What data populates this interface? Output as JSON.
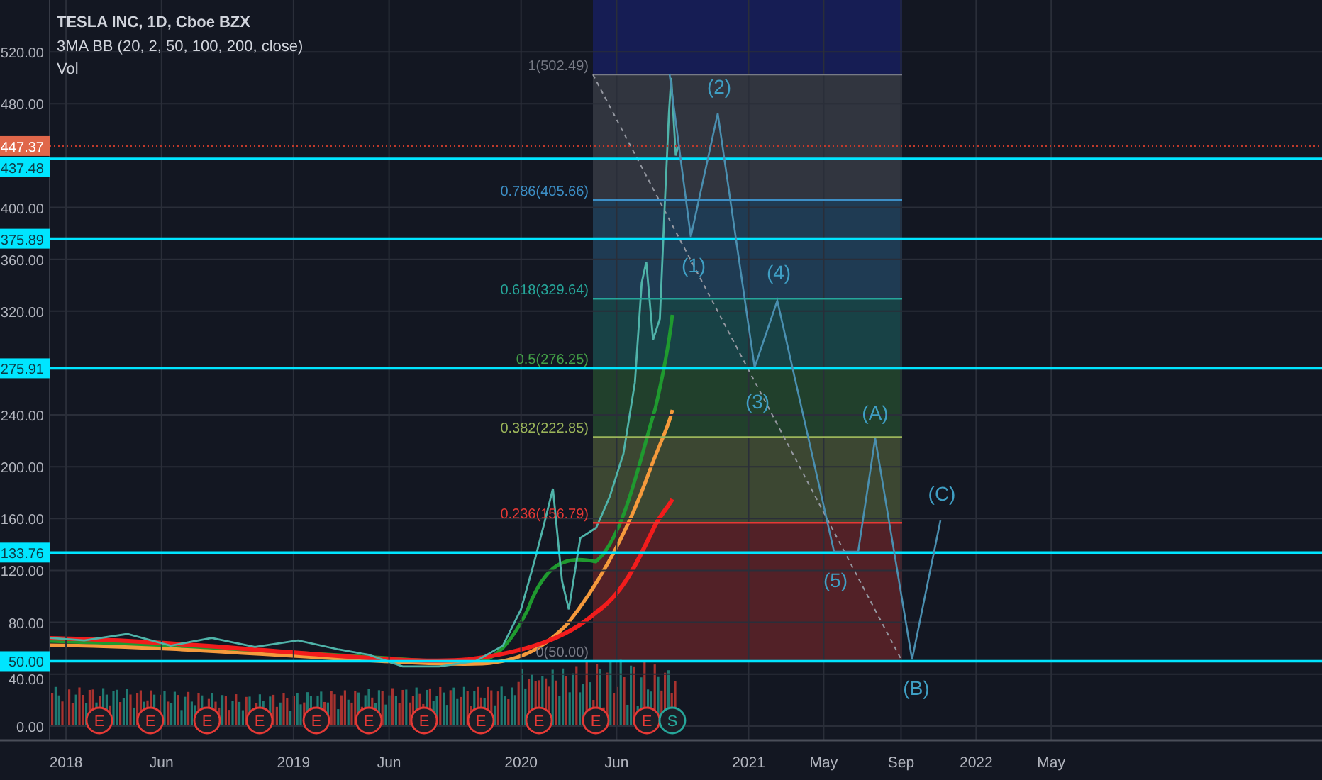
{
  "legend": {
    "title": "TESLA INC, 1D, Cboe BZX",
    "indicator": "3MA BB (20, 2, 50, 100, 200, close)",
    "volume": "Vol"
  },
  "price_levels": [
    {
      "kind": "last_price",
      "label": "447.37"
    },
    {
      "kind": "horizontal_line",
      "label": "437.48"
    },
    {
      "kind": "horizontal_line",
      "label": "375.89"
    },
    {
      "kind": "horizontal_line",
      "label": "275.91"
    },
    {
      "kind": "horizontal_line",
      "label": "133.76"
    },
    {
      "kind": "horizontal_line",
      "label": "50.00"
    }
  ],
  "fib_levels": [
    {
      "label": "1(502.49)",
      "color": "#787b86"
    },
    {
      "label": "0.786(405.66)",
      "color": "#3d8fc6"
    },
    {
      "label": "0.618(329.64)",
      "color": "#26a69a"
    },
    {
      "label": "0.5(276.25)",
      "color": "#43a047"
    },
    {
      "label": "0.382(222.85)",
      "color": "#9bb55a"
    },
    {
      "label": "0.236(156.79)",
      "color": "#e53935"
    },
    {
      "label": "0(50.00)",
      "color": "#787b86"
    }
  ],
  "wave_labels": [
    "(1)",
    "(2)",
    "(3)",
    "(4)",
    "(5)",
    "(A)",
    "(B)",
    "(C)"
  ],
  "events": [
    {
      "kind": "earnings",
      "label": "E"
    },
    {
      "kind": "earnings",
      "label": "E"
    },
    {
      "kind": "earnings",
      "label": "E"
    },
    {
      "kind": "earnings",
      "label": "E"
    },
    {
      "kind": "earnings",
      "label": "E"
    },
    {
      "kind": "earnings",
      "label": "E"
    },
    {
      "kind": "earnings",
      "label": "E"
    },
    {
      "kind": "earnings",
      "label": "E"
    },
    {
      "kind": "earnings",
      "label": "E"
    },
    {
      "kind": "earnings",
      "label": "E"
    },
    {
      "kind": "earnings",
      "label": "E"
    },
    {
      "kind": "split",
      "label": "S"
    }
  ],
  "chart_data": {
    "type": "line",
    "grid": true,
    "x": [
      2017.93,
      2018.08,
      2018.27,
      2018.46,
      2018.64,
      2018.83,
      2019.02,
      2019.2,
      2019.33,
      2019.48,
      2019.64,
      2019.8,
      2019.92,
      2020.0,
      2020.06,
      2020.1,
      2020.14,
      2020.18,
      2020.21,
      2020.26,
      2020.33,
      2020.39,
      2020.45,
      2020.5,
      2020.53,
      2020.55,
      2020.58,
      2020.61,
      2020.63,
      2020.65,
      2020.66,
      2020.68,
      2020.69
    ],
    "series": [
      {
        "color": "#4fb3a9",
        "values": [
          68,
          66,
          71,
          62,
          68,
          61,
          66,
          59,
          55,
          46,
          46,
          50,
          62,
          90,
          128,
          155,
          183,
          112,
          90,
          145,
          153,
          177,
          210,
          265,
          342,
          358,
          298,
          314,
          396,
          473,
          500,
          440,
          447
        ]
      }
    ],
    "xlim": [
      2017.71,
      2023.52
    ],
    "ylim": [
      -11,
      560
    ],
    "yticks": [
      {
        "value": 520,
        "label": "520.00"
      },
      {
        "value": 480,
        "label": "480.00"
      },
      {
        "value": 400,
        "label": "400.00"
      },
      {
        "value": 360,
        "label": "360.00"
      },
      {
        "value": 320,
        "label": "320.00"
      },
      {
        "value": 240,
        "label": "240.00"
      },
      {
        "value": 200,
        "label": "200.00"
      },
      {
        "value": 160,
        "label": "160.00"
      },
      {
        "value": 120,
        "label": "120.00"
      },
      {
        "value": 80,
        "label": "80.00"
      },
      {
        "value": 40,
        "label": "40.00"
      },
      {
        "value": 0,
        "label": "0.00"
      }
    ],
    "xticks": [
      {
        "value": 2018,
        "label": "2018"
      },
      {
        "value": 2018.42,
        "label": "Jun"
      },
      {
        "value": 2019,
        "label": "2019"
      },
      {
        "value": 2019.42,
        "label": "Jun"
      },
      {
        "value": 2020,
        "label": "2020"
      },
      {
        "value": 2020.42,
        "label": "Jun"
      },
      {
        "value": 2021,
        "label": "2021"
      },
      {
        "value": 2021.33,
        "label": "May"
      },
      {
        "value": 2021.67,
        "label": "Sep"
      },
      {
        "value": 2022,
        "label": "2022"
      },
      {
        "value": 2022.33,
        "label": "May"
      }
    ]
  }
}
